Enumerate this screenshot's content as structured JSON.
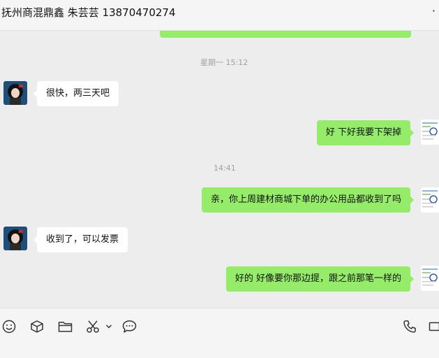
{
  "header": {
    "title": "抚州商混鼎鑫 朱芸芸 13870470274",
    "more_label": "·"
  },
  "messages": [
    {
      "type": "time",
      "text": "星期一 15:12"
    },
    {
      "type": "in",
      "text": "很快，两三天吧"
    },
    {
      "type": "out",
      "text": "好 下好我要下架掉"
    },
    {
      "type": "time",
      "text": "14:41"
    },
    {
      "type": "out",
      "text": "亲，你上周建材商城下单的办公用品都收到了吗"
    },
    {
      "type": "in",
      "text": "收到了，可以发票"
    },
    {
      "type": "out",
      "text": "好的 好像要你那边提，跟之前那笔一样的"
    }
  ],
  "toolbar": {
    "icons": [
      "emoji-icon",
      "cube-icon",
      "folder-icon",
      "scissors-icon",
      "chevron-down-icon",
      "chat-bubble-icon",
      "phone-icon",
      "video-icon"
    ]
  },
  "colors": {
    "background": "#ededed",
    "outgoing_bubble": "#95ec69",
    "incoming_bubble": "#ffffff",
    "timestamp": "#a0a0a0"
  }
}
